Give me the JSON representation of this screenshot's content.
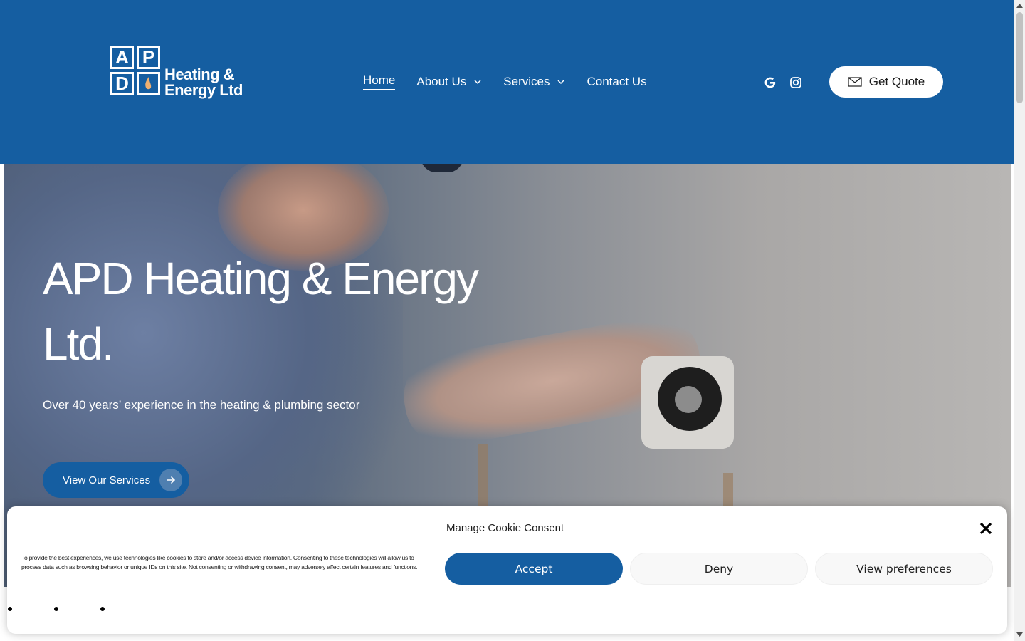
{
  "brand": {
    "logo_letters": [
      "A",
      "P",
      "D"
    ],
    "logo_line1": "Heating &",
    "logo_line2": "Energy Ltd",
    "primary_color": "#155ea1"
  },
  "nav": {
    "items": [
      {
        "label": "Home",
        "active": true,
        "has_dropdown": false
      },
      {
        "label": "About Us",
        "active": false,
        "has_dropdown": true
      },
      {
        "label": "Services",
        "active": false,
        "has_dropdown": true
      },
      {
        "label": "Contact Us",
        "active": false,
        "has_dropdown": false
      }
    ],
    "social_icons": [
      "google-icon",
      "instagram-icon"
    ],
    "quote_button": "Get Quote"
  },
  "hero": {
    "title": "APD Heating & Energy Ltd.",
    "subtitle": "Over 40 years’ experience in the heating & plumbing sector",
    "cta_label": "View Our Services"
  },
  "cookie": {
    "title": "Manage Cookie Consent",
    "body": "To provide the best experiences, we use technologies like cookies to store and/or access device information. Consenting to these technologies will allow us to process data such as browsing behavior or unique IDs on this site. Not consenting or withdrawing consent, may adversely affect certain features and functions.",
    "accept_label": "Accept",
    "deny_label": "Deny",
    "preferences_label": "View preferences",
    "accept_color": "#155ea1"
  }
}
